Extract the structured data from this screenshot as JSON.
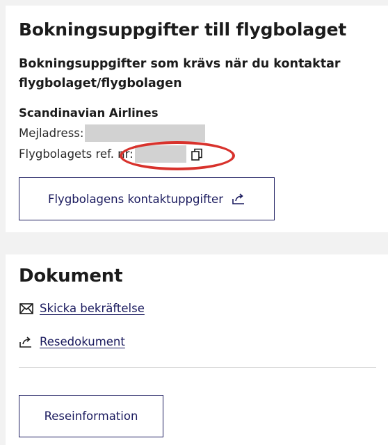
{
  "booking": {
    "title": "Bokningsuppgifter till flygbolaget",
    "subtitle": "Bokningsuppgifter som krävs när du kontaktar flygbolaget/flygbolagen",
    "airline_name": "Scandinavian Airlines",
    "email_label": "Mejladress:",
    "ref_label": "Flygbolagets ref. nr:",
    "contact_button_label": "Flygbolagens kontaktuppgifter"
  },
  "documents": {
    "title": "Dokument",
    "links": [
      {
        "label": "Skicka bekräftelse",
        "icon": "envelope-icon"
      },
      {
        "label": "Resedokument",
        "icon": "share-icon"
      }
    ],
    "info_button_label": "Reseinformation"
  },
  "colors": {
    "accent": "#1a1a5e",
    "annotation": "#d8322c",
    "mask": "#d2d2d2",
    "background": "#f2f2f2"
  }
}
